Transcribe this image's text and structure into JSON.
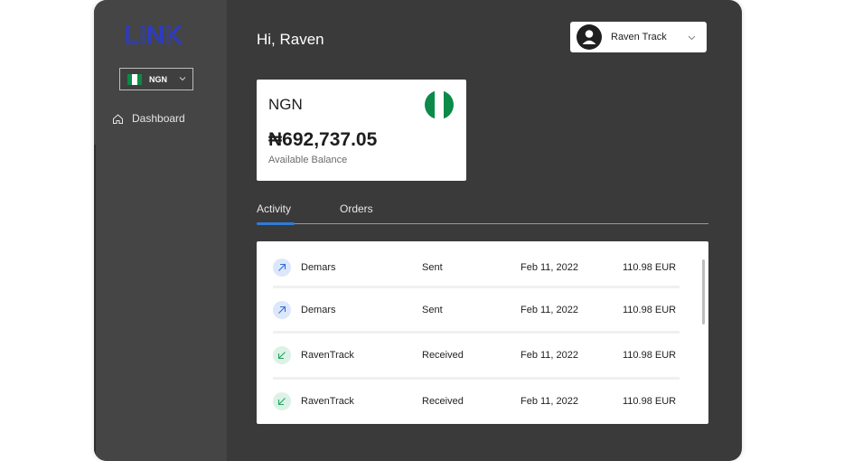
{
  "app": {
    "logo_text": "LINK"
  },
  "sidebar": {
    "currency": "NGN",
    "items": [
      {
        "label": "Dashboard",
        "icon": "home-icon"
      }
    ]
  },
  "header": {
    "greeting": "Hi, Raven",
    "user_name": "Raven Track"
  },
  "balance_card": {
    "currency": "NGN",
    "amount": "₦692,737.05",
    "label": "Available Balance"
  },
  "tabs": [
    {
      "label": "Activity",
      "active": true
    },
    {
      "label": "Orders",
      "active": false
    }
  ],
  "transactions": [
    {
      "name": "Demars",
      "type": "Sent",
      "date": "Feb 11, 2022",
      "amount": "110.98 EUR",
      "direction": "sent"
    },
    {
      "name": "Demars",
      "type": "Sent",
      "date": "Feb 11, 2022",
      "amount": "110.98 EUR",
      "direction": "sent"
    },
    {
      "name": "RavenTrack",
      "type": "Received",
      "date": "Feb 11, 2022",
      "amount": "110.98 EUR",
      "direction": "received"
    },
    {
      "name": "RavenTrack",
      "type": "Received",
      "date": "Feb 11, 2022",
      "amount": "110.98 EUR",
      "direction": "received"
    }
  ],
  "colors": {
    "accent": "#2f7cd8",
    "logo": "#2a3bd6",
    "flag_green": "#0b8a4a",
    "sent_icon": "#2f6fd8",
    "received_icon": "#27a463"
  }
}
